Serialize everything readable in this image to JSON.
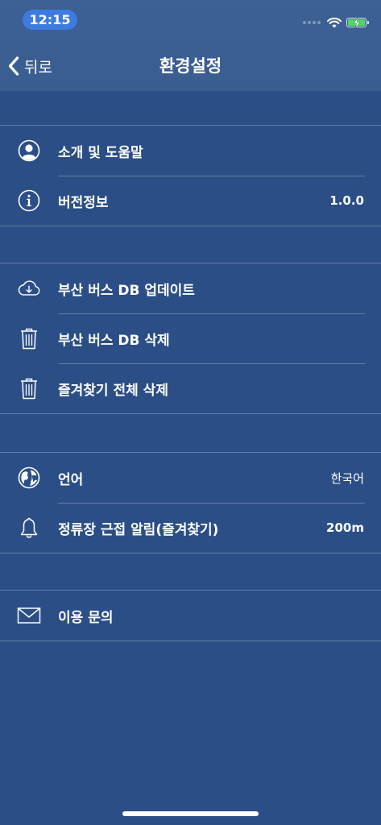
{
  "status_bar": {
    "time": "12:15",
    "battery_color": "#4cd964",
    "time_badge_color": "#3d7be0"
  },
  "nav": {
    "back_label": "뒤로",
    "title": "환경설정"
  },
  "theme": {
    "background": "#2b4e86",
    "header_background": "#3a5d91"
  },
  "sections": [
    {
      "items": [
        {
          "icon": "user-icon",
          "label": "소개 및 도움말",
          "value": ""
        },
        {
          "icon": "info-icon",
          "label": "버전정보",
          "value": "1.0.0"
        }
      ]
    },
    {
      "items": [
        {
          "icon": "cloud-download-icon",
          "label": "부산 버스 DB 업데이트",
          "value": ""
        },
        {
          "icon": "trash-icon",
          "label": "부산 버스 DB 삭제",
          "value": ""
        },
        {
          "icon": "trash-icon",
          "label": "즐겨찾기 전체 삭제",
          "value": ""
        }
      ]
    },
    {
      "items": [
        {
          "icon": "globe-icon",
          "label": "언어",
          "value": "한국어"
        },
        {
          "icon": "bell-icon",
          "label": "정류장 근접 알림(즐겨찾기)",
          "value": "200m"
        }
      ]
    },
    {
      "items": [
        {
          "icon": "envelope-icon",
          "label": "이용 문의",
          "value": ""
        }
      ]
    }
  ]
}
